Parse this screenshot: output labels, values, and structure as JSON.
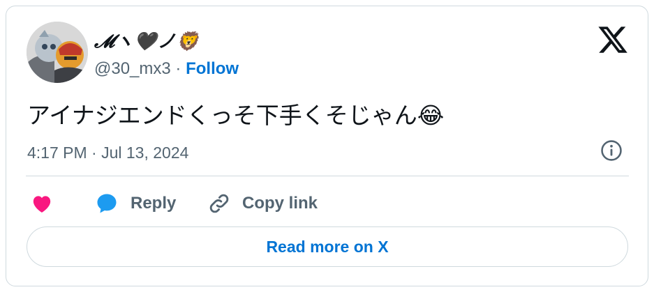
{
  "author": {
    "display_name": "𝓜ヽ🖤ノ🦁",
    "handle": "@30_mx3",
    "separator": " · ",
    "follow_label": "Follow"
  },
  "tweet": {
    "text": "アイナジエンドくっそ下手くそじゃん😂",
    "timestamp": "4:17 PM · Jul 13, 2024"
  },
  "actions": {
    "reply_label": "Reply",
    "copy_link_label": "Copy link"
  },
  "footer": {
    "read_more_label": "Read more on X"
  },
  "colors": {
    "accent": "#0074d4",
    "like": "#f91880",
    "reply_icon": "#1d9bf0",
    "muted": "#536471",
    "border": "#cfd9de"
  },
  "icons": [
    "x-logo-icon",
    "info-icon",
    "heart-icon",
    "reply-bubble-icon",
    "link-icon"
  ]
}
